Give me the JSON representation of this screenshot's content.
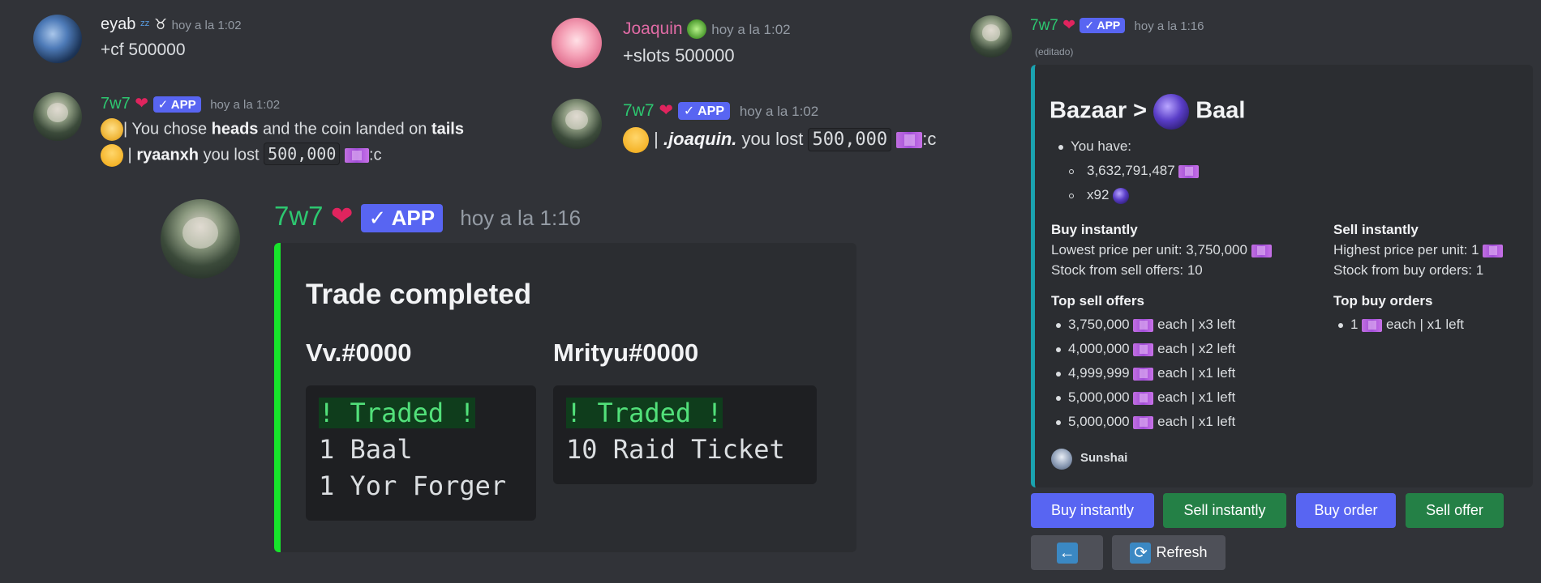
{
  "colors": {
    "background": "#313338",
    "blurple": "#5865f2",
    "green_button": "#248046",
    "grey_button": "#4e5058",
    "trade_accent": "#17e42b",
    "bazaar_accent": "#1aa3b0",
    "bot_name": "#2dc770",
    "joaquin_name": "#e06ba5"
  },
  "msg_eyab": {
    "username": "eyab",
    "badge_icons": [
      "sleeping-zzz-icon",
      "cow-icon"
    ],
    "timestamp": "hoy a la 1:02",
    "text": "+cf 500000"
  },
  "msg_joaquin": {
    "username": "Joaquin",
    "badge_icons": [
      "alien-icon"
    ],
    "timestamp": "hoy a la 1:02",
    "text": "+slots 500000"
  },
  "msg_bot_cf": {
    "username": "7w7",
    "app_badge": "APP",
    "timestamp": "hoy a la 1:02",
    "line1_pre": "| You chose ",
    "line1_heads": "heads",
    "line1_mid": " and the coin landed on ",
    "line1_tails": "tails",
    "line2_user": "ryaanxh",
    "line2_mid": " you lost ",
    "line2_amount": "500,000",
    "line2_tail": ":c"
  },
  "msg_bot_slots": {
    "username": "7w7",
    "app_badge": "APP",
    "timestamp": "hoy a la 1:02",
    "user": ".joaquin.",
    "mid": " you lost ",
    "amount": "500,000",
    "tail": ":c"
  },
  "msg_bot_trade": {
    "username": "7w7",
    "app_badge": "APP",
    "timestamp": "hoy a la 1:16",
    "embed_title": "Trade completed",
    "left_user": "Vv.#0000",
    "left_lines": [
      "! Traded !",
      "1 Baal",
      "1 Yor Forger"
    ],
    "right_user": "Mrityu#0000",
    "right_lines": [
      "! Traded !",
      "10 Raid Ticket"
    ]
  },
  "msg_bot_bazaar": {
    "username": "7w7",
    "app_badge": "APP",
    "timestamp": "hoy a la 1:16",
    "edited": "(editado)",
    "title_prefix": "Bazaar >",
    "title_item": "Baal",
    "you_have": "You have:",
    "have_cash": "3,632,791,487",
    "have_items": "x92",
    "buy_heading": "Buy instantly",
    "buy_line1": "Lowest price per unit: 3,750,000",
    "buy_line2": "Stock from sell offers: 10",
    "sell_heading": "Sell instantly",
    "sell_line1": "Highest price per unit: 1",
    "sell_line2": "Stock from buy orders: 1",
    "top_sell_heading": "Top sell offers",
    "top_sell": [
      {
        "price": "3,750,000",
        "rest": "each | x3 left"
      },
      {
        "price": "4,000,000",
        "rest": "each | x2 left"
      },
      {
        "price": "4,999,999",
        "rest": "each | x1 left"
      },
      {
        "price": "5,000,000",
        "rest": "each | x1 left"
      },
      {
        "price": "5,000,000",
        "rest": "each | x1 left"
      }
    ],
    "top_buy_heading": "Top buy orders",
    "top_buy": [
      {
        "price": "1",
        "rest": "each | x1 left"
      }
    ],
    "footer_name": "Sunshai",
    "buttons": {
      "buy_instantly": "Buy instantly",
      "sell_instantly": "Sell instantly",
      "buy_order": "Buy order",
      "sell_offer": "Sell offer",
      "refresh": "Refresh"
    }
  }
}
